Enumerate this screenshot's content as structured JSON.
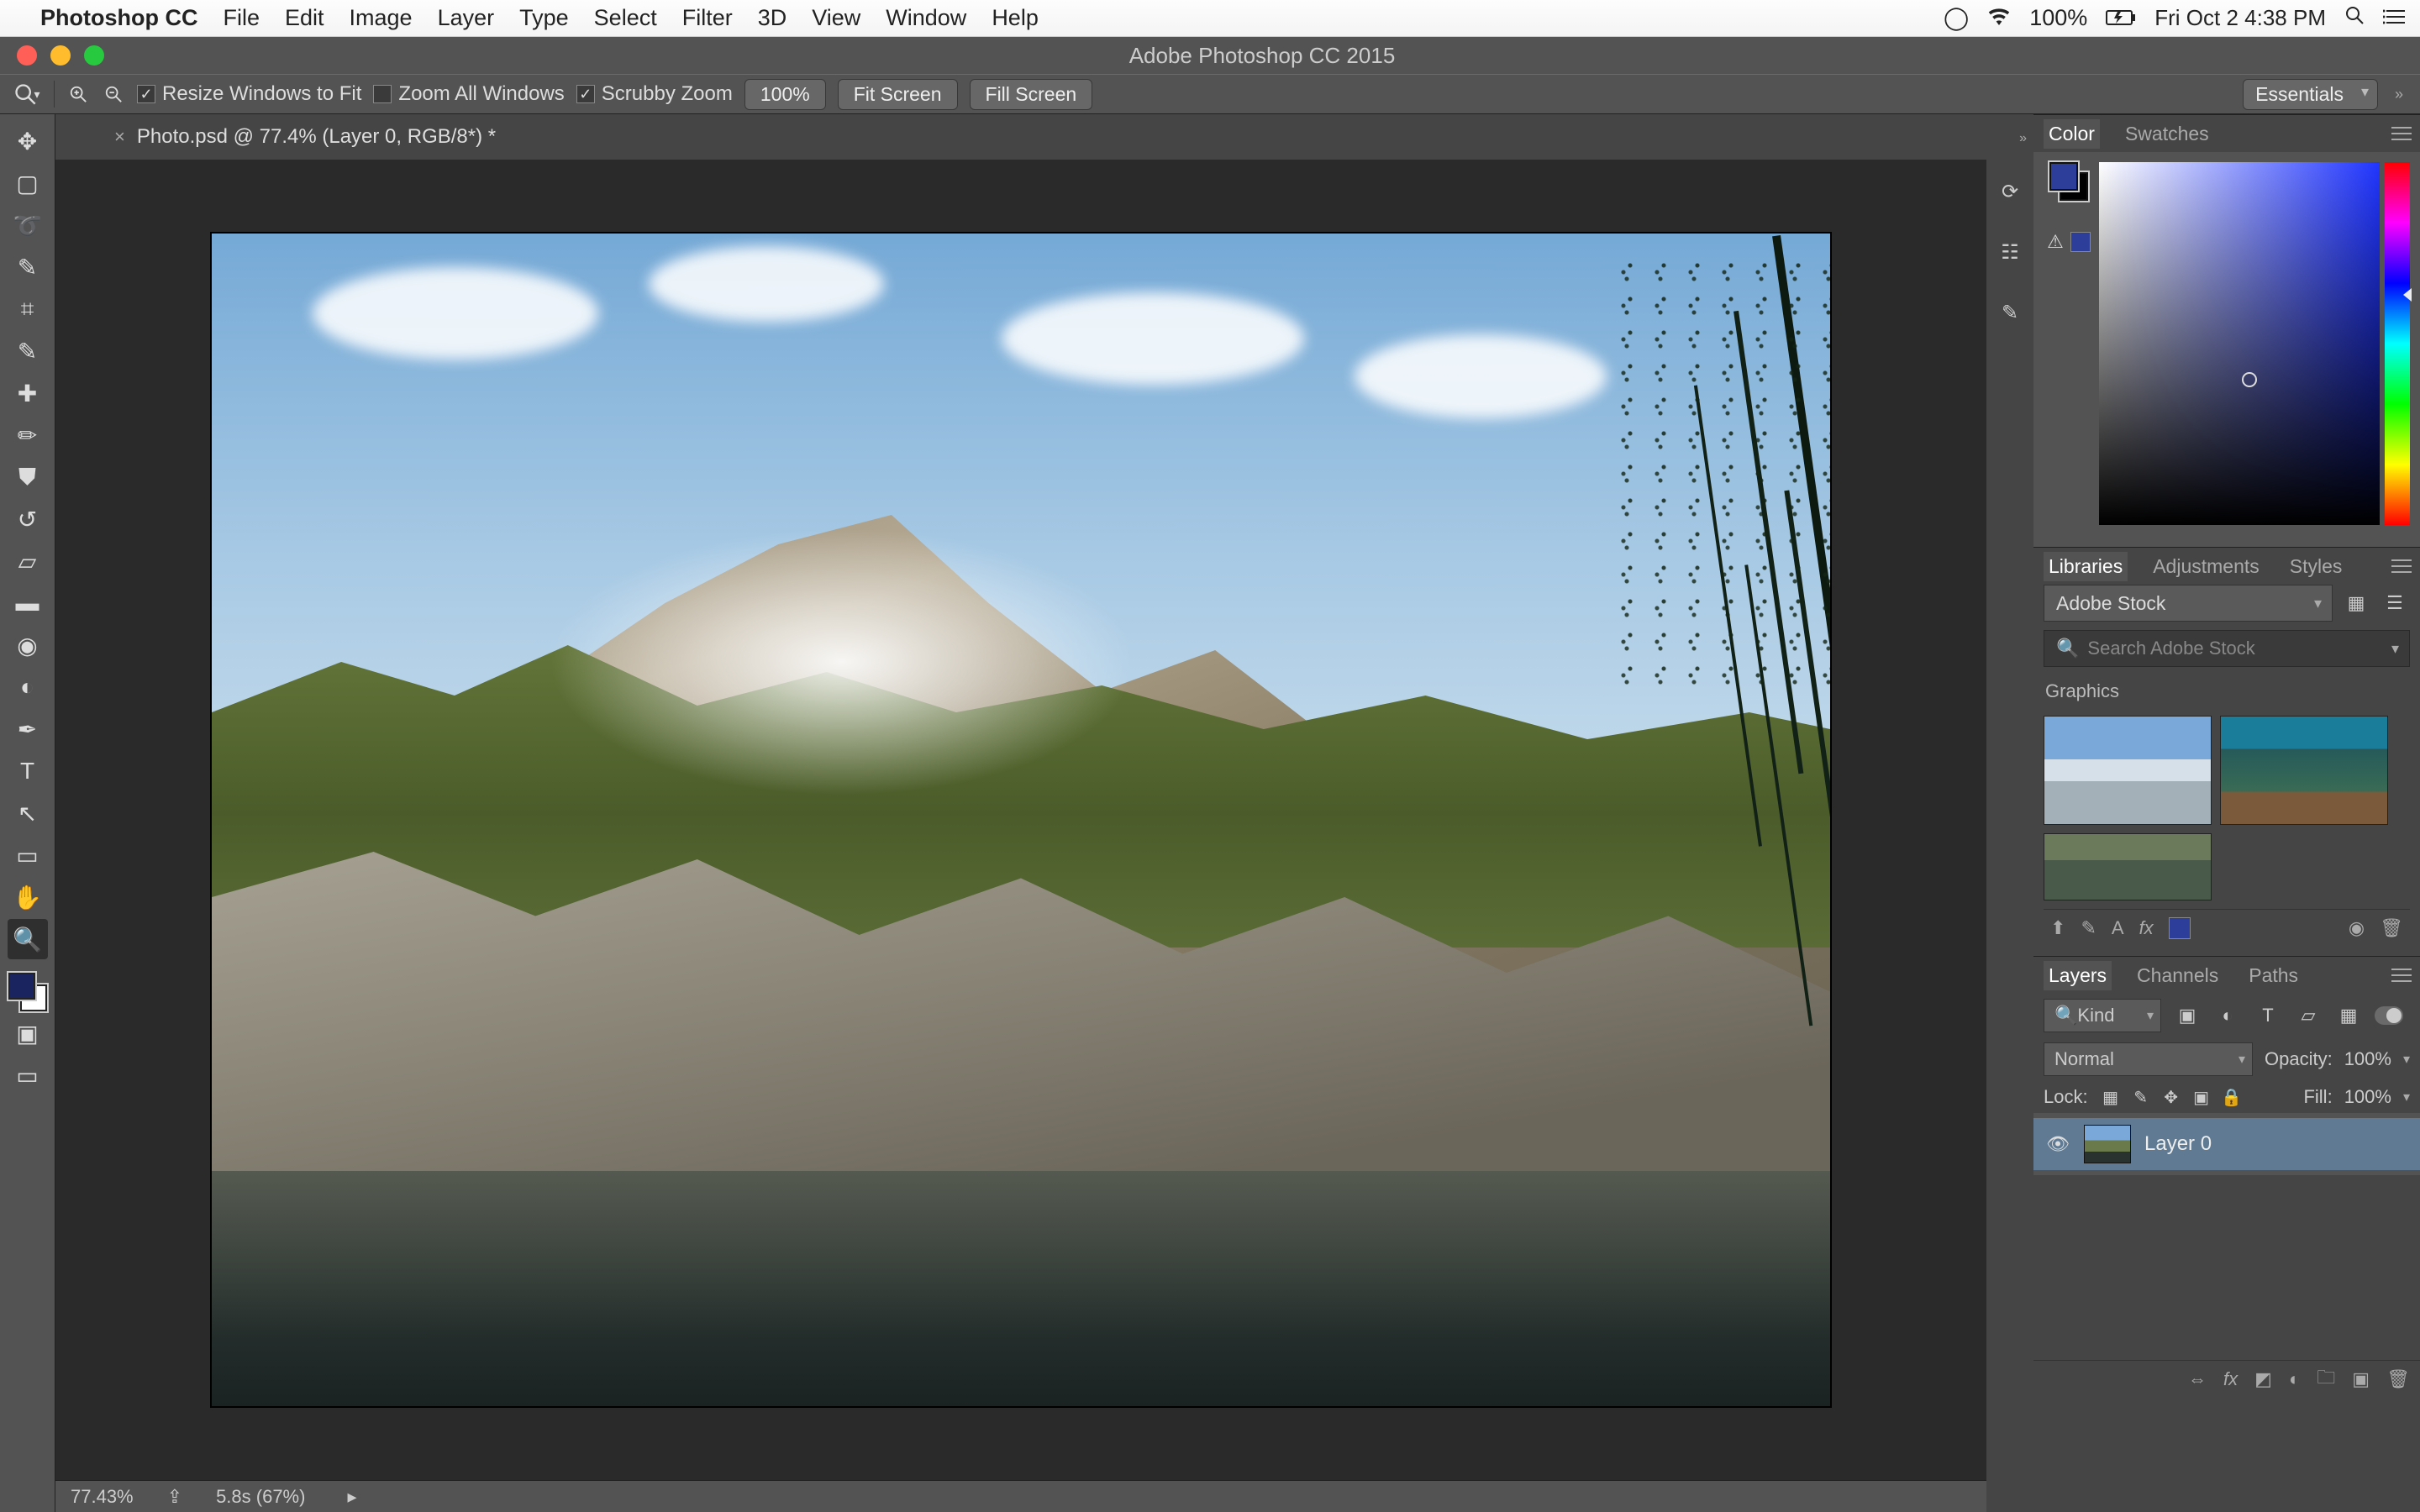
{
  "menubar": {
    "app": "Photoshop CC",
    "items": [
      "File",
      "Edit",
      "Image",
      "Layer",
      "Type",
      "Select",
      "Filter",
      "3D",
      "View",
      "Window",
      "Help"
    ],
    "battery": "100%",
    "clock": "Fri Oct 2  4:38 PM"
  },
  "window": {
    "title": "Adobe Photoshop CC 2015"
  },
  "options": {
    "resize_windows": "Resize Windows to Fit",
    "zoom_all": "Zoom All Windows",
    "scrubby": "Scrubby Zoom",
    "zoom_pct": "100%",
    "fit": "Fit Screen",
    "fill": "Fill Screen",
    "workspace": "Essentials"
  },
  "doc": {
    "tab": "Photo.psd @ 77.4% (Layer 0, RGB/8*) *"
  },
  "status": {
    "zoom": "77.43%",
    "timing": "5.8s (67%)"
  },
  "panels": {
    "color_tabs": [
      "Color",
      "Swatches"
    ],
    "lib_tabs": [
      "Libraries",
      "Adjustments",
      "Styles"
    ],
    "lib_source": "Adobe Stock",
    "lib_search_ph": "Search Adobe Stock",
    "lib_section": "Graphics",
    "layer_tabs": [
      "Layers",
      "Channels",
      "Paths"
    ],
    "kind_label": "Kind",
    "blend": "Normal",
    "opacity_lbl": "Opacity:",
    "opacity_val": "100%",
    "lock_lbl": "Lock:",
    "fill_lbl": "Fill:",
    "fill_val": "100%",
    "layer0": "Layer 0"
  }
}
